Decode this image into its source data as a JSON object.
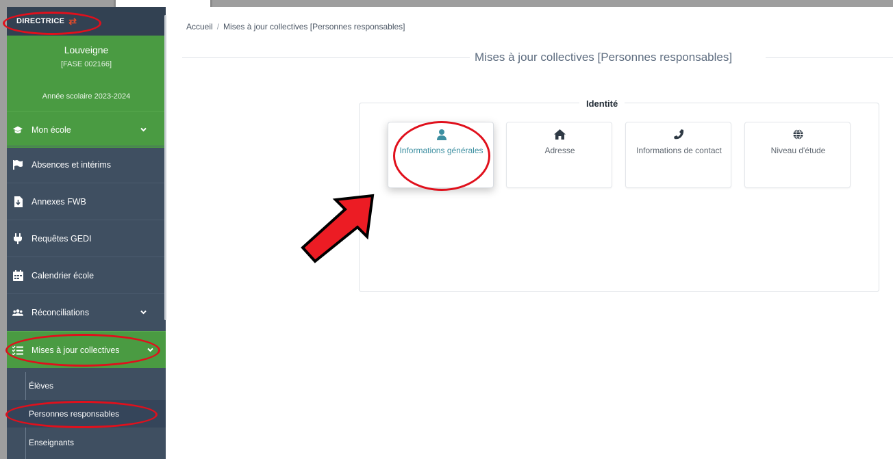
{
  "sidebar": {
    "role": "DIRECTRICE",
    "school_name": "Louveigne",
    "school_code": "[FASE 002166]",
    "school_year": "Année scolaire 2023-2024",
    "items": [
      {
        "label": "Mon école",
        "icon": "graduation-cap-icon"
      },
      {
        "label": "Absences et intérims",
        "icon": "flag-icon"
      },
      {
        "label": "Annexes FWB",
        "icon": "file-download-icon"
      },
      {
        "label": "Requêtes GEDI",
        "icon": "plug-icon"
      },
      {
        "label": "Calendrier école",
        "icon": "calendar-icon"
      },
      {
        "label": "Réconciliations",
        "icon": "users-icon"
      },
      {
        "label": "Mises à jour collectives",
        "icon": "list-check-icon"
      }
    ],
    "subitems": [
      {
        "label": "Élèves"
      },
      {
        "label": "Personnes responsables"
      },
      {
        "label": "Enseignants"
      }
    ]
  },
  "breadcrumb": {
    "home": "Accueil",
    "separator": "/",
    "current": "Mises à jour collectives [Personnes responsables]"
  },
  "page_title": "Mises à jour collectives [Personnes responsables]",
  "section": {
    "legend": "Identité",
    "cards": [
      {
        "label": "Informations générales",
        "icon": "user-icon"
      },
      {
        "label": "Adresse",
        "icon": "home-icon"
      },
      {
        "label": "Informations de contact",
        "icon": "phone-icon"
      },
      {
        "label": "Niveau d'étude",
        "icon": "globe-icon"
      }
    ]
  },
  "colors": {
    "sidebar_bg": "#3f4f61",
    "sidebar_green": "#4a9b42",
    "accent_teal": "#3d8fa1",
    "annotation_red": "#e0101c"
  }
}
